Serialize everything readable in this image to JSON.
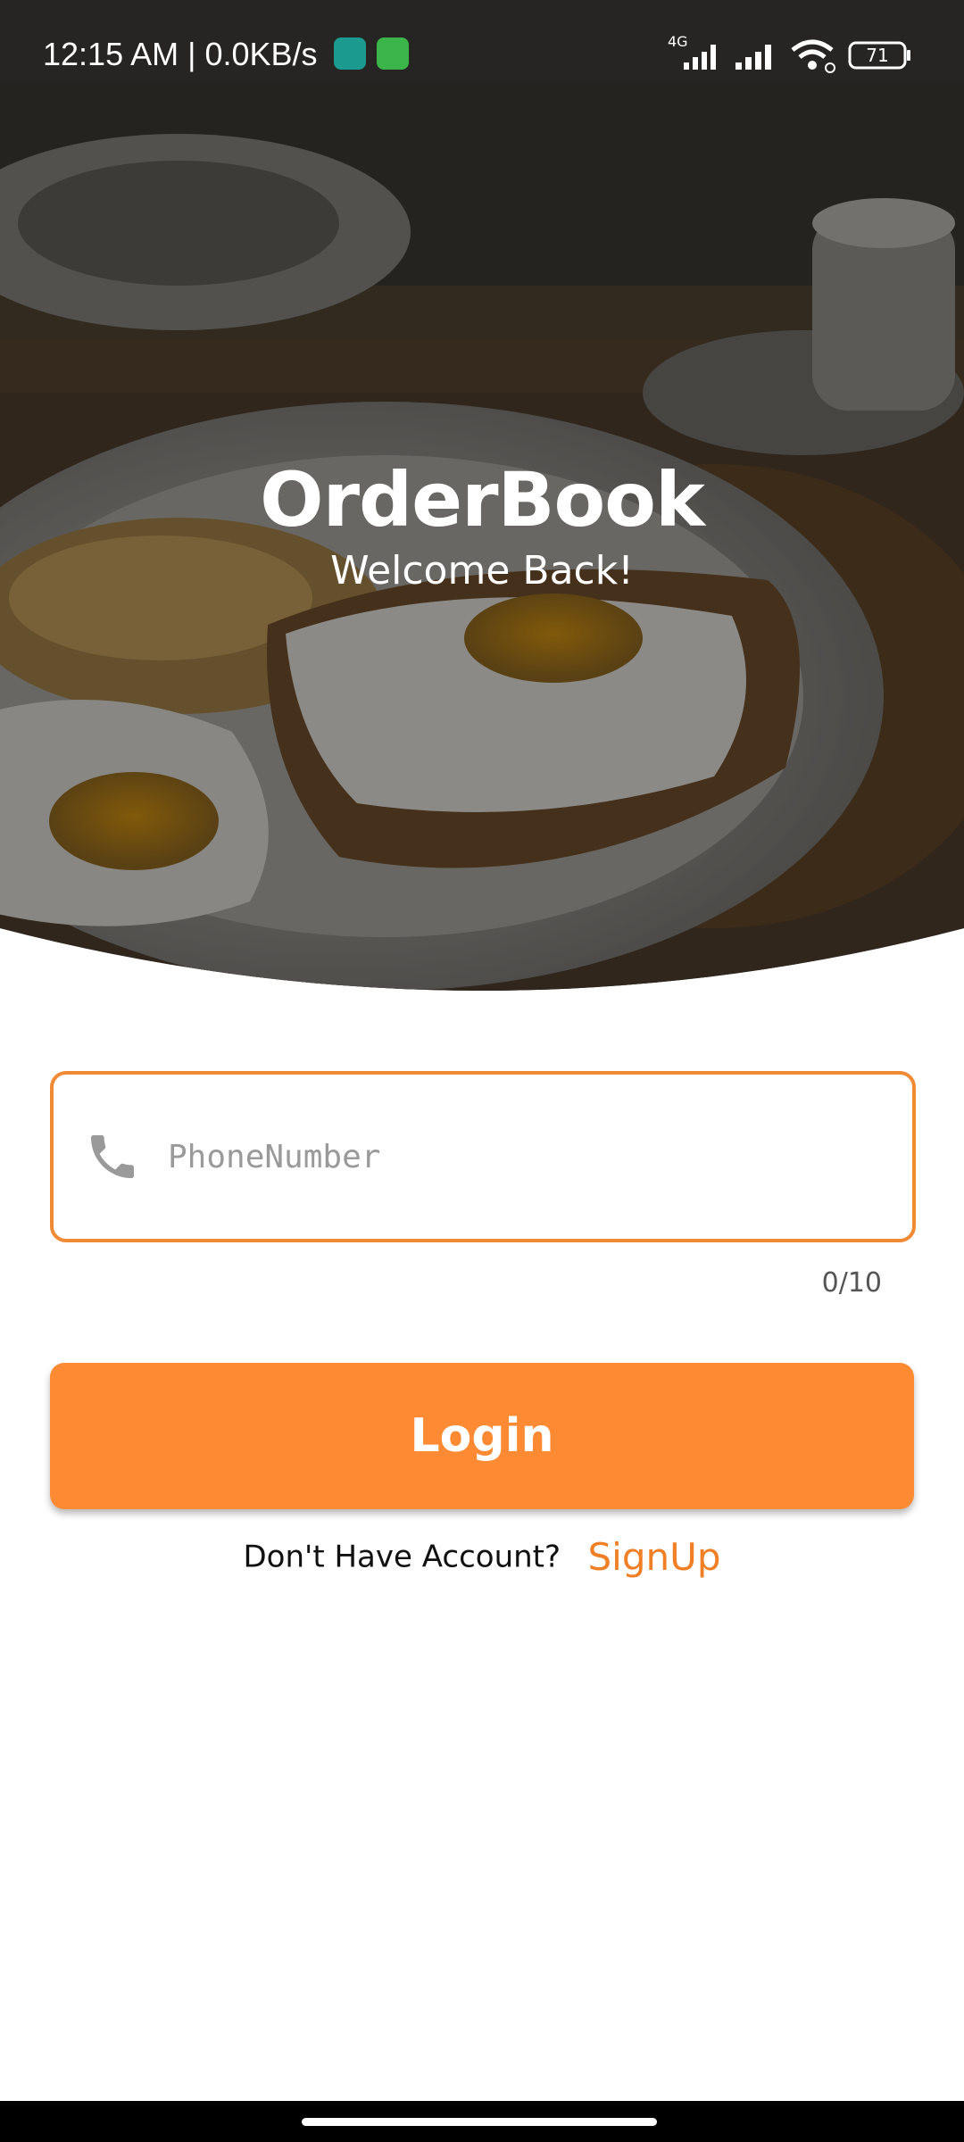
{
  "status_bar": {
    "time": "12:15 AM | 0.0KB/s",
    "network_label": "4G",
    "battery": "71"
  },
  "header": {
    "app_title": "OrderBook",
    "subtitle": "Welcome Back!"
  },
  "form": {
    "phone_placeholder": "PhoneNumber",
    "phone_value": "",
    "char_counter": "0/10",
    "login_label": "Login"
  },
  "signup": {
    "prompt": "Don't Have Account?",
    "link_label": "SignUp"
  },
  "colors": {
    "accent": "#fe8a33",
    "field_border": "#f08a35",
    "signup_link": "#f07f25"
  },
  "icons": {
    "phone": "phone-icon",
    "wifi": "wifi-icon",
    "signal": "signal-icon",
    "battery": "battery-icon"
  }
}
